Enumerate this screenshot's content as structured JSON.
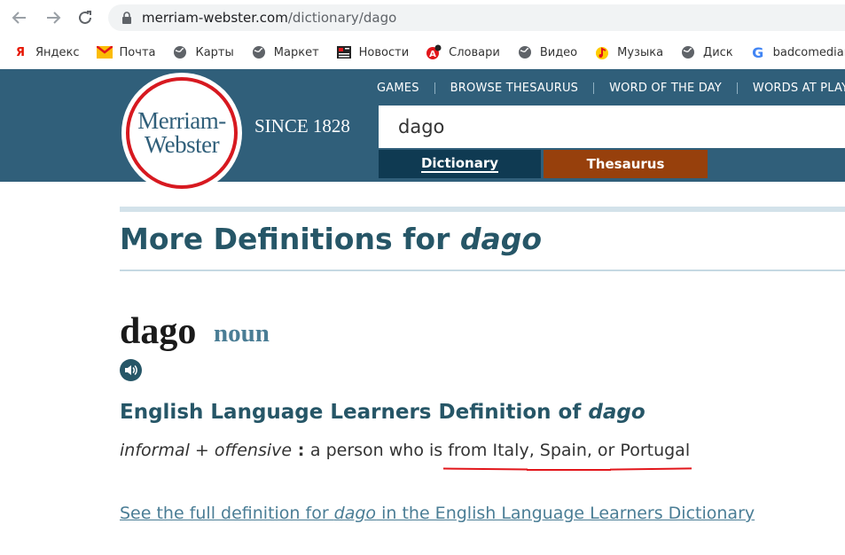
{
  "browser": {
    "url_host": "merriam-webster.com",
    "url_path": "/dictionary/dago",
    "bookmarks": [
      {
        "label": "Яндекс",
        "icon": "yandex-icon"
      },
      {
        "label": "Почта",
        "icon": "mail-icon"
      },
      {
        "label": "Карты",
        "icon": "globe-icon"
      },
      {
        "label": "Маркет",
        "icon": "globe-icon"
      },
      {
        "label": "Новости",
        "icon": "news-icon"
      },
      {
        "label": "Словари",
        "icon": "dictionary-icon"
      },
      {
        "label": "Видео",
        "icon": "globe-icon"
      },
      {
        "label": "Музыка",
        "icon": "music-icon"
      },
      {
        "label": "Диск",
        "icon": "globe-icon"
      },
      {
        "label": "badcomedian - Г",
        "icon": "google-icon"
      }
    ]
  },
  "header": {
    "logo_line1": "Merriam-",
    "logo_line2": "Webster",
    "since": "SINCE 1828",
    "nav": [
      "GAMES",
      "BROWSE THESAURUS",
      "WORD OF THE DAY",
      "WORDS AT PLAY"
    ],
    "search_value": "dago",
    "tab_dictionary": "Dictionary",
    "tab_thesaurus": "Thesaurus",
    "colors": {
      "header_bg": "#305f7a",
      "dictionary_tab": "#0f3a52",
      "thesaurus_tab": "#97400c",
      "logo_ring": "#d71920"
    }
  },
  "content": {
    "section_title_prefix": "More Definitions for ",
    "section_title_word": "dago",
    "headword": "dago",
    "part_of_speech": "noun",
    "learner_prefix": "English Language Learners Definition of ",
    "learner_word": "dago",
    "label_informal": "informal",
    "label_plus": " + ",
    "label_offensive": "offensive",
    "colon": " : ",
    "definition": "a person who is from Italy, Spain, or Portugal",
    "link_prefix": "See the full definition for ",
    "link_word": "dago",
    "link_suffix": " in the English Language Learners Dictionary"
  }
}
